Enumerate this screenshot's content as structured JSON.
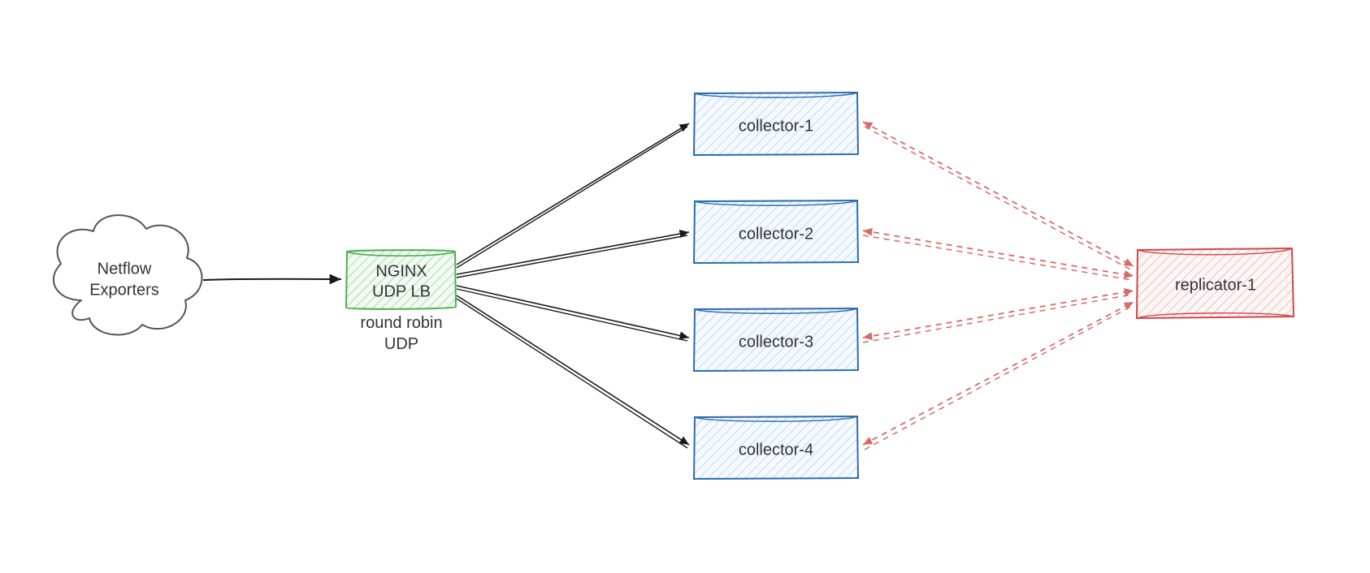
{
  "nodes": {
    "exporters": {
      "line1": "Netflow",
      "line2": "Exporters"
    },
    "nginx": {
      "line1": "NGINX",
      "line2": "UDP LB",
      "sub1": "round robin",
      "sub2": "UDP"
    },
    "collector1": "collector-1",
    "collector2": "collector-2",
    "collector3": "collector-3",
    "collector4": "collector-4",
    "replicator": "replicator-1"
  },
  "colors": {
    "cloud_stroke": "#555555",
    "nginx_stroke": "#4caf50",
    "nginx_fill": "#e8f5e9",
    "collector_stroke": "#2b6cb0",
    "collector_fill": "#eef5fd",
    "replicator_stroke": "#d04848",
    "replicator_fill": "#fdecec",
    "solid_arrow": "#1a1a1a",
    "dashed_arrow": "#d66a6a"
  },
  "chart_data": {
    "type": "flow-diagram",
    "nodes": [
      {
        "id": "exporters",
        "label": "Netflow Exporters",
        "kind": "cloud"
      },
      {
        "id": "nginx",
        "label": "NGINX UDP LB",
        "annotation": "round robin UDP",
        "kind": "loadbalancer"
      },
      {
        "id": "collector-1",
        "label": "collector-1",
        "kind": "collector"
      },
      {
        "id": "collector-2",
        "label": "collector-2",
        "kind": "collector"
      },
      {
        "id": "collector-3",
        "label": "collector-3",
        "kind": "collector"
      },
      {
        "id": "collector-4",
        "label": "collector-4",
        "kind": "collector"
      },
      {
        "id": "replicator-1",
        "label": "replicator-1",
        "kind": "replicator"
      }
    ],
    "edges": [
      {
        "from": "exporters",
        "to": "nginx",
        "style": "solid",
        "direction": "forward"
      },
      {
        "from": "nginx",
        "to": "collector-1",
        "style": "solid-double",
        "direction": "forward"
      },
      {
        "from": "nginx",
        "to": "collector-2",
        "style": "solid-double",
        "direction": "forward"
      },
      {
        "from": "nginx",
        "to": "collector-3",
        "style": "solid-double",
        "direction": "forward"
      },
      {
        "from": "nginx",
        "to": "collector-4",
        "style": "solid-double",
        "direction": "forward"
      },
      {
        "from": "collector-1",
        "to": "replicator-1",
        "style": "dashed-double",
        "direction": "bidirectional"
      },
      {
        "from": "collector-2",
        "to": "replicator-1",
        "style": "dashed-double",
        "direction": "bidirectional"
      },
      {
        "from": "collector-3",
        "to": "replicator-1",
        "style": "dashed-double",
        "direction": "bidirectional"
      },
      {
        "from": "collector-4",
        "to": "replicator-1",
        "style": "dashed-double",
        "direction": "bidirectional"
      }
    ]
  }
}
